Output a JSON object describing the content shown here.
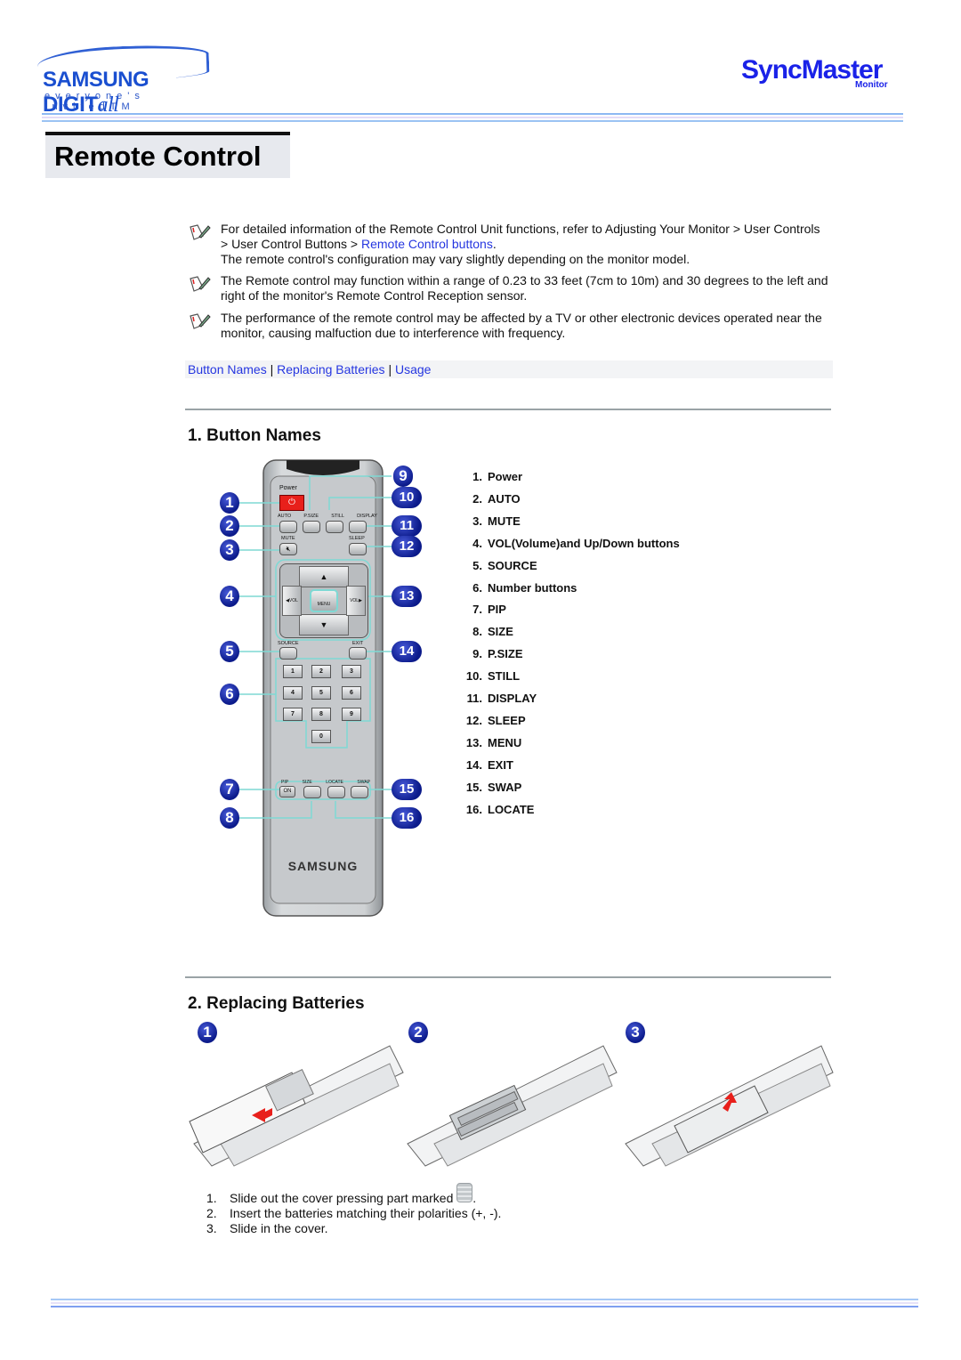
{
  "header": {
    "brand_name": "SAMSUNG DIGIT",
    "brand_suffix": "all",
    "brand_tagline": "everyone's invitedTM",
    "product_name": "SyncMaster",
    "product_sub": "Monitor",
    "rule_colors": [
      "#8db8f3",
      "#e4dcf7",
      "#9bc3f3"
    ]
  },
  "page_title": "Remote Control",
  "notes": [
    {
      "icon": "note-pencil-icon",
      "text_before": "For detailed information of the Remote Control Unit functions, refer to Adjusting Your Monitor > User Controls > User Control Buttons > ",
      "link": "Remote Control buttons",
      "text_after": ".",
      "second_line": "The remote control's configuration may vary slightly depending on the monitor model."
    },
    {
      "icon": "note-pencil-icon",
      "text": "The Remote control may function within a range of 0.23 to 33 feet (7cm to 10m) and 30 degrees to the left and right of the monitor's Remote Control Reception sensor."
    },
    {
      "icon": "note-pencil-icon",
      "text": "The performance of the remote control may be affected by a TV or other electronic devices operated near the monitor, causing malfuction due to interference with frequency."
    }
  ],
  "section_nav": {
    "links": [
      "Button Names",
      "Replacing Batteries",
      "Usage"
    ],
    "separator": "|"
  },
  "sections": {
    "button_names": {
      "heading": "1. Button Names",
      "items": [
        {
          "num": "1.",
          "label": "Power"
        },
        {
          "num": "2.",
          "label": "AUTO"
        },
        {
          "num": "3.",
          "label": "MUTE"
        },
        {
          "num": "4.",
          "label": "VOL(Volume)and Up/Down buttons"
        },
        {
          "num": "5.",
          "label": "SOURCE"
        },
        {
          "num": "6.",
          "label": "Number buttons"
        },
        {
          "num": "7.",
          "label": "PIP"
        },
        {
          "num": "8.",
          "label": "SIZE"
        },
        {
          "num": "9.",
          "label": "P.SIZE"
        },
        {
          "num": "10.",
          "label": "STILL"
        },
        {
          "num": "11.",
          "label": "DISPLAY"
        },
        {
          "num": "12.",
          "label": "SLEEP"
        },
        {
          "num": "13.",
          "label": "MENU"
        },
        {
          "num": "14.",
          "label": "EXIT"
        },
        {
          "num": "15.",
          "label": "SWAP"
        },
        {
          "num": "16.",
          "label": "LOCATE"
        }
      ]
    },
    "replacing_batteries": {
      "heading": "2. Replacing Batteries",
      "step_badges": [
        "1",
        "2",
        "3"
      ],
      "steps": [
        {
          "num": "1.",
          "text": "Slide out the cover pressing part marked",
          "suffix": "."
        },
        {
          "num": "2.",
          "text": "Insert the batteries matching their polarities (+, -)."
        },
        {
          "num": "3.",
          "text": "Slide in the cover."
        }
      ]
    }
  },
  "remote": {
    "power_label": "Power",
    "top_row": [
      "AUTO",
      "P.SIZE",
      "STILL",
      "DISPLAY"
    ],
    "mute_label": "MUTE",
    "sleep_label": "SLEEP",
    "vol_left": "◀VOL",
    "vol_right": "VOL▶",
    "menu_label": "MENU",
    "source_label": "SOURCE",
    "exit_label": "EXIT",
    "digits": [
      "1",
      "2",
      "3",
      "4",
      "5",
      "6",
      "7",
      "8",
      "9",
      "0"
    ],
    "pip_labels": [
      "PIP",
      "SIZE",
      "LOCATE",
      "SWAP"
    ],
    "pip_on": "ON",
    "brand": "SAMSUNG",
    "callouts_left": [
      "1",
      "2",
      "3",
      "4",
      "5",
      "6",
      "7",
      "8"
    ],
    "callouts_right": [
      "9",
      "10",
      "11",
      "12",
      "13",
      "14",
      "15",
      "16"
    ],
    "accent_red": "#e8201b",
    "callout_line": "#7fd9d4"
  }
}
